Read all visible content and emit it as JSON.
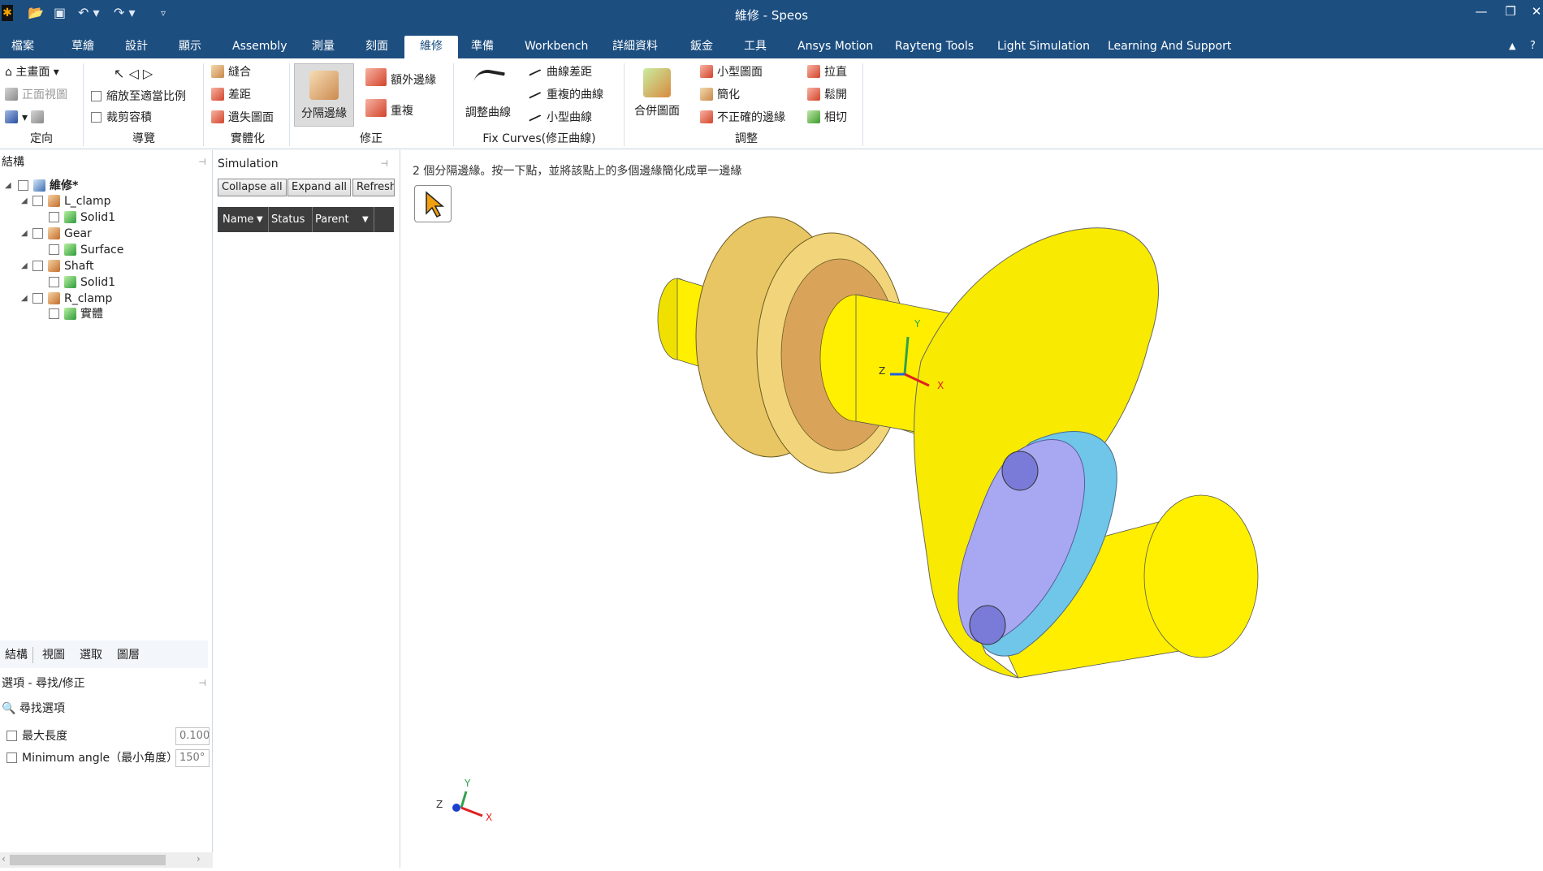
{
  "window": {
    "title": "維修 - Speos",
    "minimize": "—",
    "restore": "❐",
    "close": "✕"
  },
  "tabs": [
    "檔案",
    "草繪",
    "設計",
    "顯示",
    "Assembly",
    "測量",
    "刻面",
    "維修",
    "準備",
    "Workbench",
    "詳細資料",
    "鈑金",
    "工具",
    "Ansys Motion",
    "Rayteng Tools",
    "Light Simulation",
    "Learning And Support"
  ],
  "active_tab": "維修",
  "ribbon": {
    "orient": {
      "home": "主畫面",
      "front_view": "正面視圖",
      "label": "定向"
    },
    "navigate": {
      "zoom_fit": "縮放至適當比例",
      "clip_volume": "裁剪容積",
      "label": "導覽"
    },
    "solidify": {
      "stitch": "縫合",
      "gap": "差距",
      "missing_faces": "遺失圖面",
      "label": "實體化"
    },
    "fix": {
      "split_edges": "分隔邊緣",
      "extra_edges": "額外邊緣",
      "duplicates": "重複",
      "label": "修正"
    },
    "fix_curves": {
      "adjust_curves": "調整曲線",
      "curve_gap": "曲線差距",
      "duplicate_curves": "重複的曲線",
      "small_curves": "小型曲線",
      "label": "Fix Curves(修正曲線)"
    },
    "adjust": {
      "merge_faces": "合併圖面",
      "small_faces": "小型圖面",
      "simplify": "簡化",
      "inexact_edges": "不正確的邊緣",
      "straighten": "拉直",
      "relax": "鬆開",
      "tangent": "相切",
      "label": "調整"
    }
  },
  "structure": {
    "header": "結構",
    "tree": [
      {
        "label": "維修*",
        "level": 0
      },
      {
        "label": "L_clamp",
        "level": 1
      },
      {
        "label": "Solid1",
        "level": 2
      },
      {
        "label": "Gear",
        "level": 1
      },
      {
        "label": "Surface",
        "level": 2
      },
      {
        "label": "Shaft",
        "level": 1
      },
      {
        "label": "Solid1",
        "level": 2
      },
      {
        "label": "R_clamp",
        "level": 1
      },
      {
        "label": "實體",
        "level": 2
      }
    ],
    "tabs": [
      "結構",
      "視圖",
      "選取",
      "圖層"
    ]
  },
  "options": {
    "header": "選項 - 尋找/修正",
    "find_options": "尋找選項",
    "max_length_label": "最大長度",
    "max_length_value": "0.100",
    "min_angle_label": "Minimum angle（最小角度）",
    "min_angle_value": "150°"
  },
  "simulation": {
    "header": "Simulation",
    "collapse": "Collapse all",
    "expand": "Expand all",
    "refresh": "Refresh",
    "columns": [
      "Name",
      "Status",
      "Parent"
    ]
  },
  "viewport": {
    "hint": "2 個分隔邊緣。按一下點，並將該點上的多個邊緣簡化成單一邊緣",
    "axis_labels": {
      "x": "X",
      "y": "Y",
      "z": "Z"
    }
  }
}
